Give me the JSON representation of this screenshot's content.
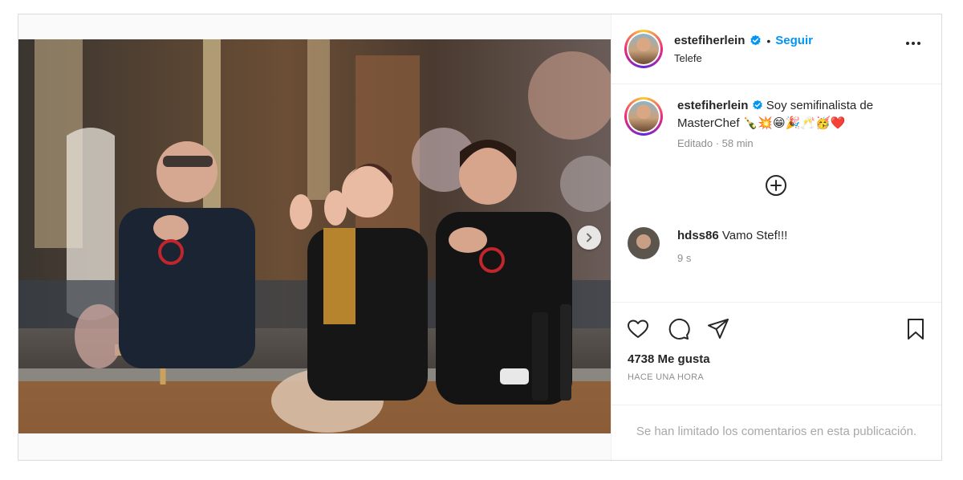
{
  "post": {
    "author": {
      "username": "estefiherlein",
      "verified": true,
      "subtitle": "Telefe"
    },
    "header": {
      "separator": "•",
      "follow_label": "Seguir"
    },
    "caption": {
      "username": "estefiherlein",
      "text": "Soy semifinalista de MasterChef 🍾💥😁🎉🥂🥳❤️",
      "meta": "Editado · 58 min"
    },
    "comments": [
      {
        "username": "hdss86",
        "text": "Vamo Stef!!!",
        "time": "9 s"
      }
    ],
    "likes": "4738 Me gusta",
    "posted": "HACE UNA HORA",
    "comments_limited": "Se han limitado los comentarios en esta publicación.",
    "carousel": {
      "slides": 5,
      "active": 0
    },
    "colors": {
      "accent": "#0095f6",
      "verified": "#0095f6",
      "text": "#262626",
      "muted": "#8e8e8e"
    },
    "icons": [
      "verified-badge-icon",
      "more-options-icon",
      "load-more-comments-icon",
      "like-heart-icon",
      "comment-bubble-icon",
      "share-send-icon",
      "save-bookmark-icon",
      "carousel-next-icon"
    ]
  }
}
